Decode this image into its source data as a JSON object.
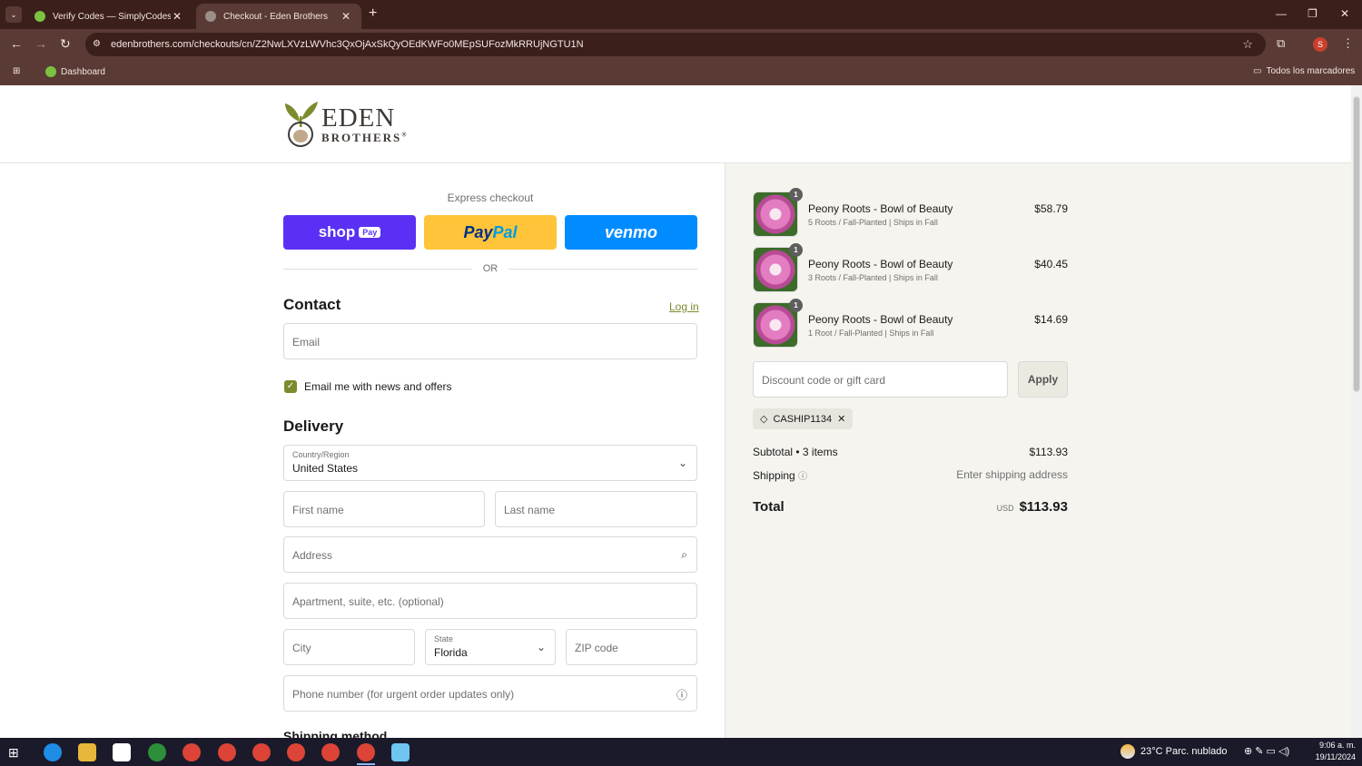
{
  "browser": {
    "tabs": [
      {
        "title": "Verify Codes — SimplyCodes",
        "active": false
      },
      {
        "title": "Checkout - Eden Brothers",
        "active": true
      }
    ],
    "url": "edenbrothers.com/checkouts/cn/Z2NwLXVzLWVhc3QxOjAxSkQyOEdKWFo0MEpSUFozMkRRUjNGTU1N",
    "bookmarks": {
      "dashboard": "Dashboard",
      "all": "Todos los marcadores"
    },
    "profile_initial": "S"
  },
  "brand": {
    "line1": "EDEN",
    "line2": "BROTHERS",
    "mark": "®",
    "green": "#7a8c2d"
  },
  "express": {
    "label": "Express checkout",
    "shop": "shop",
    "shop_pill": "Pay",
    "paypal_a": "Pay",
    "paypal_b": "Pal",
    "venmo": "venmo",
    "or": "OR"
  },
  "contact": {
    "heading": "Contact",
    "login": "Log in",
    "email_placeholder": "Email",
    "news_label": "Email me with news and offers"
  },
  "delivery": {
    "heading": "Delivery",
    "country_label": "Country/Region",
    "country_value": "United States",
    "first_name": "First name",
    "last_name": "Last name",
    "address": "Address",
    "apartment": "Apartment, suite, etc. (optional)",
    "city": "City",
    "state_label": "State",
    "state_value": "Florida",
    "zip": "ZIP code",
    "phone": "Phone number (for urgent order updates only)",
    "shipping_method": "Shipping method"
  },
  "cart": {
    "items": [
      {
        "name": "Peony Roots - Bowl of Beauty",
        "variant": "5 Roots / Fall-Planted | Ships in Fall",
        "price": "$58.79",
        "qty": "1"
      },
      {
        "name": "Peony Roots - Bowl of Beauty",
        "variant": "3 Roots / Fall-Planted | Ships in Fall",
        "price": "$40.45",
        "qty": "1"
      },
      {
        "name": "Peony Roots - Bowl of Beauty",
        "variant": "1 Root / Fall-Planted | Ships in Fall",
        "price": "$14.69",
        "qty": "1"
      }
    ],
    "discount_placeholder": "Discount code or gift card",
    "apply": "Apply",
    "applied_code": "CASHIP1134",
    "subtotal_label": "Subtotal • 3 items",
    "subtotal": "$113.93",
    "shipping_label": "Shipping",
    "shipping_value": "Enter shipping address",
    "total_label": "Total",
    "currency": "USD",
    "total": "$113.93"
  },
  "taskbar": {
    "weather": "23°C  Parc. nublado",
    "time": "9:06 a. m.",
    "date": "19/11/2024"
  }
}
